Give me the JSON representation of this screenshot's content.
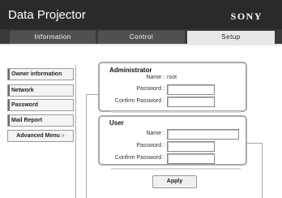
{
  "header": {
    "title": "Data Projector",
    "brand": "SONY"
  },
  "tabs": [
    {
      "label": "Information"
    },
    {
      "label": "Control"
    },
    {
      "label": "Setup"
    }
  ],
  "sidebar": {
    "items": [
      {
        "label": "Owner information"
      },
      {
        "label": "Network"
      },
      {
        "label": "Password"
      },
      {
        "label": "Mail Report"
      }
    ],
    "advanced": {
      "label": "Advanced Menu",
      "chevron": "»"
    }
  },
  "administrator": {
    "title": "Administrator",
    "name_label": "Name :",
    "name_value": "root",
    "password_label": "Password :",
    "confirm_label": "Confirm Password :"
  },
  "user": {
    "title": "User",
    "name_label": "Name :",
    "password_label": "Password :",
    "confirm_label": "Confirm Password :"
  },
  "apply_label": "Apply"
}
